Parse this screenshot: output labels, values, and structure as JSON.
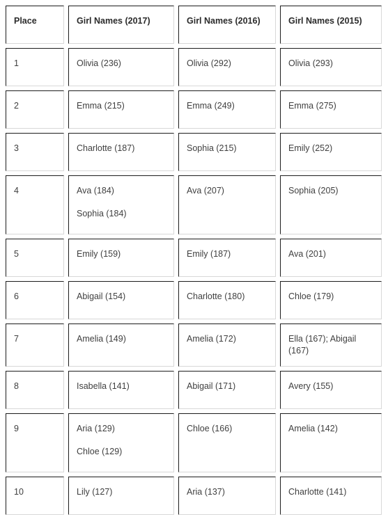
{
  "table": {
    "columns": [
      {
        "key": "place",
        "label": "Place"
      },
      {
        "key": "y2017",
        "label": "Girl Names (2017)"
      },
      {
        "key": "y2016",
        "label": "Girl Names (2016)"
      },
      {
        "key": "y2015",
        "label": "Girl Names (2015)"
      }
    ],
    "rows": [
      {
        "place": "1",
        "y2017": [
          "Olivia (236)"
        ],
        "y2016": [
          "Olivia (292)"
        ],
        "y2015": [
          "Olivia (293)"
        ]
      },
      {
        "place": "2",
        "y2017": [
          "Emma (215)"
        ],
        "y2016": [
          "Emma (249)"
        ],
        "y2015": [
          "Emma (275)"
        ]
      },
      {
        "place": "3",
        "y2017": [
          "Charlotte (187)"
        ],
        "y2016": [
          "Sophia (215)"
        ],
        "y2015": [
          "Emily (252)"
        ]
      },
      {
        "place": "4",
        "y2017": [
          "Ava (184)",
          "Sophia (184)"
        ],
        "y2016": [
          "Ava (207)"
        ],
        "y2015": [
          "Sophia (205)"
        ]
      },
      {
        "place": "5",
        "y2017": [
          "Emily (159)"
        ],
        "y2016": [
          "Emily (187)"
        ],
        "y2015": [
          "Ava (201)"
        ]
      },
      {
        "place": "6",
        "y2017": [
          "Abigail (154)"
        ],
        "y2016": [
          "Charlotte (180)"
        ],
        "y2015": [
          "Chloe (179)"
        ]
      },
      {
        "place": "7",
        "y2017": [
          "Amelia (149)"
        ],
        "y2016": [
          "Amelia (172)"
        ],
        "y2015": [
          "Ella (167); Abigail (167)"
        ]
      },
      {
        "place": "8",
        "y2017": [
          "Isabella (141)"
        ],
        "y2016": [
          "Abigail (171)"
        ],
        "y2015": [
          "Avery (155)"
        ]
      },
      {
        "place": "9",
        "y2017": [
          "Aria (129)",
          "Chloe (129)"
        ],
        "y2016": [
          "Chloe (166)"
        ],
        "y2015": [
          "Amelia (142)"
        ]
      },
      {
        "place": "10",
        "y2017": [
          "Lily (127)"
        ],
        "y2016": [
          "Aria (137)"
        ],
        "y2015": [
          "Charlotte (141)"
        ]
      }
    ]
  },
  "colors": {
    "border_dark": "#1c1c1c",
    "border_light": "#d8d8d8",
    "text": "#3f3f3f",
    "header_text": "#2b2b2b",
    "background": "#ffffff"
  }
}
